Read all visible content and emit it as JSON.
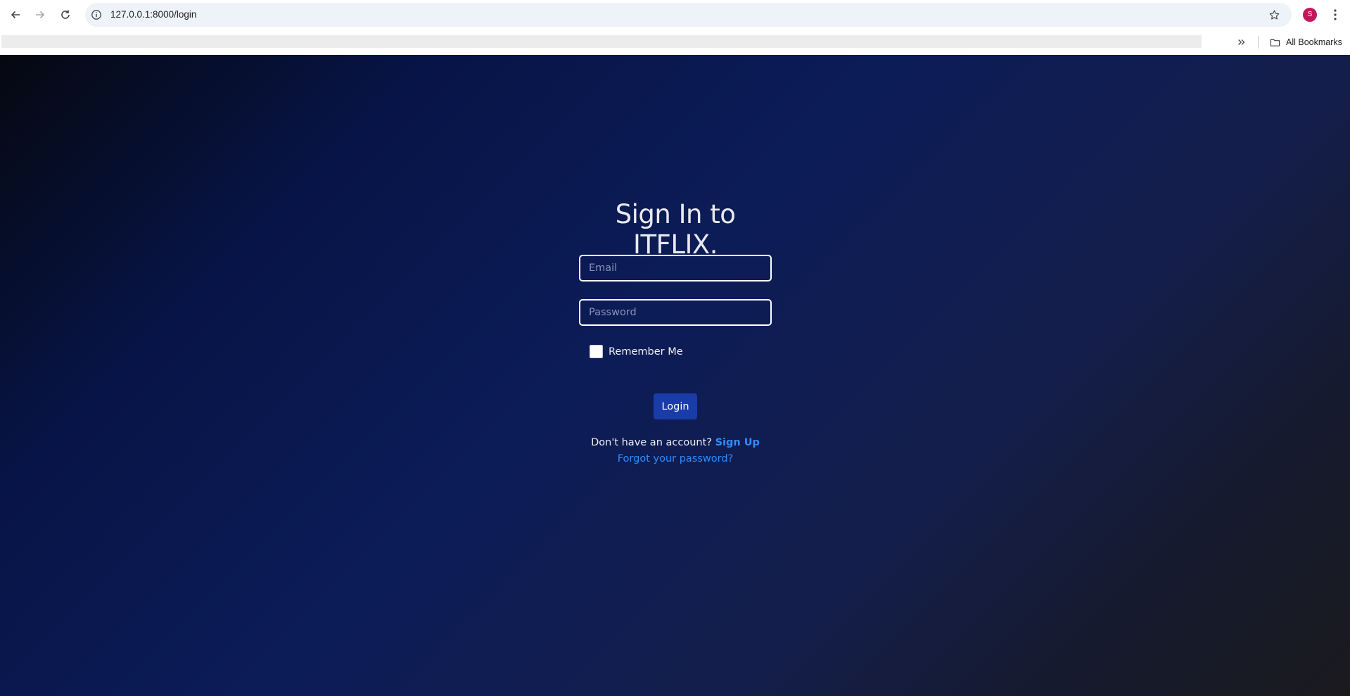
{
  "browser": {
    "url": "127.0.0.1:8000/login",
    "avatar_letter": "S",
    "all_bookmarks_label": "All Bookmarks"
  },
  "icons": {
    "back": "back-arrow-icon",
    "forward": "forward-arrow-icon",
    "reload": "reload-icon",
    "site_info": "info-icon",
    "bookmark_star": "star-icon",
    "menu": "vertical-dots-icon",
    "more_bookmarks": "double-chevron-icon",
    "folder": "folder-icon"
  },
  "login": {
    "title": "Sign In to ITFLIX.",
    "email_placeholder": "Email",
    "password_placeholder": "Password",
    "remember_label": "Remember Me",
    "login_button": "Login",
    "signup_prompt": "Don't have an account?",
    "signup_link": "Sign Up",
    "forgot_link": "Forgot your password?"
  },
  "colors": {
    "accent_button": "#1a3ca8",
    "link": "#2f8cff",
    "avatar": "#c2185b"
  }
}
